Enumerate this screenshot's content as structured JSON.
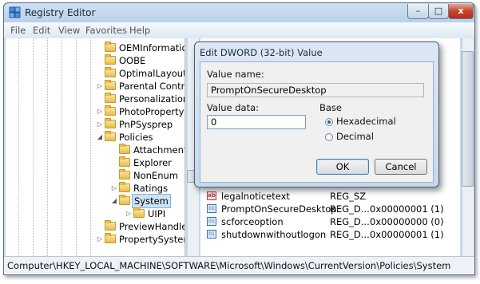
{
  "window": {
    "title": "Registry Editor",
    "close_glyph": "x",
    "min_glyph": "–",
    "max_glyph": "□"
  },
  "menu": [
    "File",
    "Edit",
    "View",
    "Favorites",
    "Help"
  ],
  "tree": {
    "items": [
      {
        "label": "OEMInformation",
        "arrow": ""
      },
      {
        "label": "OOBE",
        "arrow": ""
      },
      {
        "label": "OptimalLayout",
        "arrow": ""
      },
      {
        "label": "Parental Controls",
        "arrow": "▷"
      },
      {
        "label": "Personalization",
        "arrow": ""
      },
      {
        "label": "PhotoPropertyHa",
        "arrow": "▷"
      },
      {
        "label": "PnPSysprep",
        "arrow": "▷"
      },
      {
        "label": "Policies",
        "arrow": "◢"
      },
      {
        "label": "Attachments",
        "arrow": ""
      },
      {
        "label": "Explorer",
        "arrow": ""
      },
      {
        "label": "NonEnum",
        "arrow": ""
      },
      {
        "label": "Ratings",
        "arrow": "▷"
      },
      {
        "label": "System",
        "arrow": "◢"
      },
      {
        "label": "UIPI",
        "arrow": "▷"
      },
      {
        "label": "PreviewHandlers",
        "arrow": ""
      },
      {
        "label": "PropertySystem",
        "arrow": "▷"
      }
    ]
  },
  "list": {
    "rows": [
      {
        "name": "legalnoticetext",
        "type": "REG_SZ",
        "data": "",
        "icon": "string-value-icon"
      },
      {
        "name": "PromptOnSecureDesktop",
        "type": "REG_D...",
        "data": "0x00000001 (1)",
        "icon": "dword-value-icon"
      },
      {
        "name": "scforceoption",
        "type": "REG_D...",
        "data": "0x00000000 (0)",
        "icon": "dword-value-icon"
      },
      {
        "name": "shutdownwithoutlogon",
        "type": "REG_D...",
        "data": "0x00000001 (1)",
        "icon": "dword-value-icon"
      }
    ]
  },
  "status": {
    "path": "Computer\\HKEY_LOCAL_MACHINE\\SOFTWARE\\Microsoft\\Windows\\CurrentVersion\\Policies\\System"
  },
  "dialog": {
    "title": "Edit DWORD (32-bit) Value",
    "value_name_label": "Value name:",
    "value_name": "PromptOnSecureDesktop",
    "value_data_label": "Value data:",
    "value_data": "0",
    "base_label": "Base",
    "hex_label": "Hexadecimal",
    "dec_label": "Decimal",
    "base_selected": "Hexadecimal",
    "ok_label": "OK",
    "cancel_label": "Cancel"
  }
}
